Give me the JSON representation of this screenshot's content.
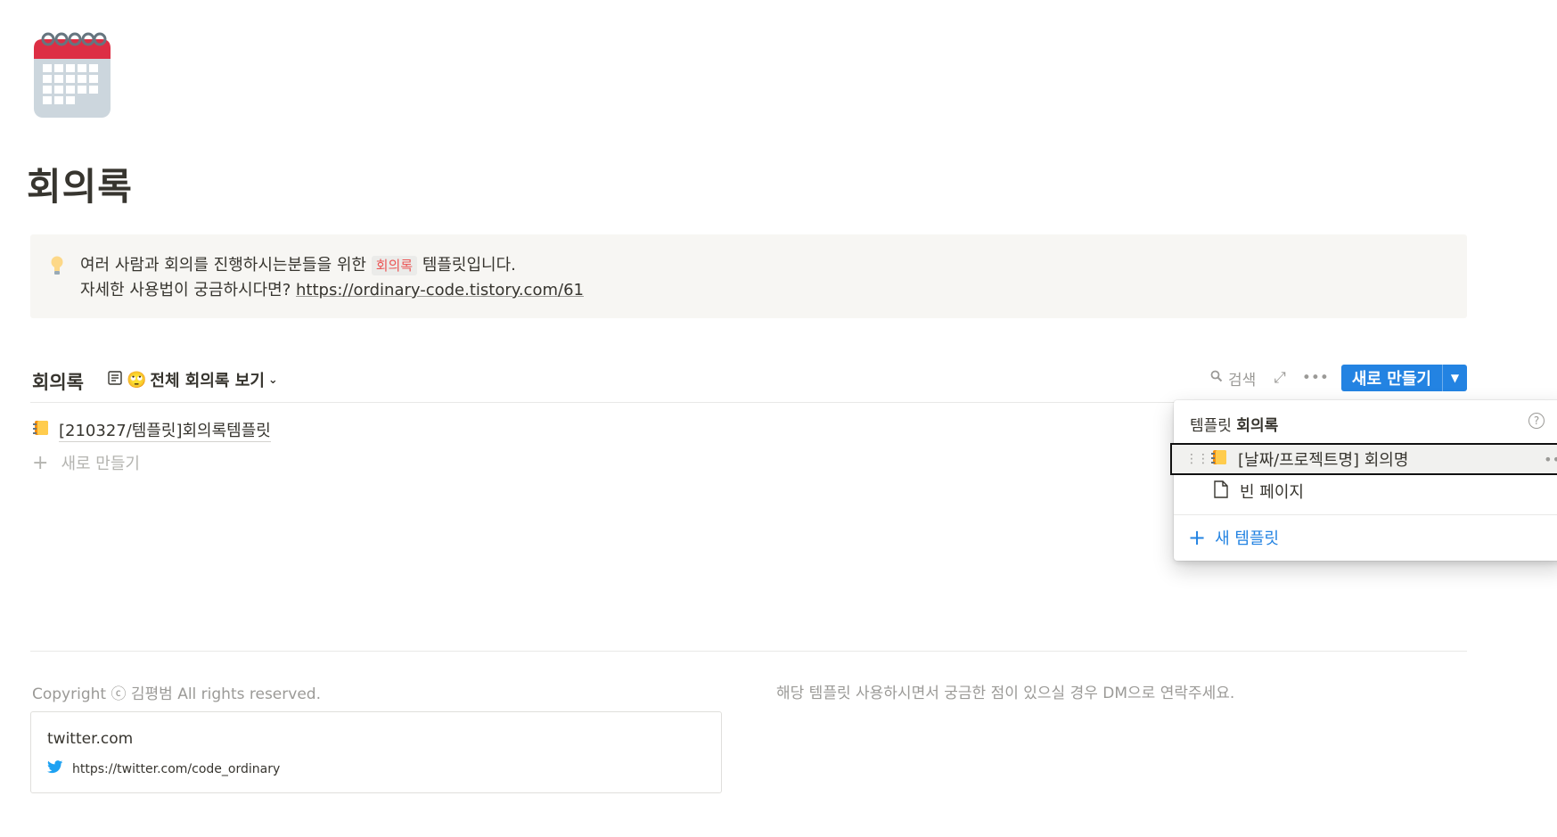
{
  "page": {
    "icon": "calendar-icon",
    "title": "회의록"
  },
  "callout": {
    "icon": "lightbulb-icon",
    "line1_before": "여러 사람과 회의를 진행하시는분들을 위한 ",
    "line1_code": "회의록",
    "line1_after": " 템플릿입니다.",
    "line2_before": "자세한 사용법이 궁금하시다면? ",
    "line2_link": "https://ordinary-code.tistory.com/61"
  },
  "database": {
    "title": "회의록",
    "view_icon": "list-view-icon",
    "view_emoji": "🙄",
    "view_label": "전체 회의록 보기",
    "toolbar": {
      "search_label": "검색",
      "new_label": "새로 만들기"
    },
    "rows": [
      {
        "icon": "notebook-icon",
        "title": "[210327/템플릿]회의록템플릿"
      }
    ],
    "add_row_label": "새로 만들기"
  },
  "template_menu": {
    "header_prefix": "템플릿",
    "header_db": "회의록",
    "items": [
      {
        "icon": "notebook-icon",
        "label": "[날짜/프로젝트명] 회의명"
      },
      {
        "icon": "page-icon",
        "label": "빈 페이지"
      }
    ],
    "new_template_label": "새 템플릿"
  },
  "footer": {
    "copyright": "Copyright ⓒ 김평범 All rights reserved.",
    "note": "해당 템플릿 사용하시면서 궁금한 점이 있으실 경우 DM으로 연락주세요.",
    "bookmark": {
      "title": "twitter.com",
      "url": "https://twitter.com/code_ordinary",
      "icon": "twitter-icon"
    }
  },
  "colors": {
    "accent": "#2383e2",
    "callout_bg": "#f7f6f3",
    "inline_code": "#eb5757",
    "calendar_red": "#dd2e44"
  }
}
